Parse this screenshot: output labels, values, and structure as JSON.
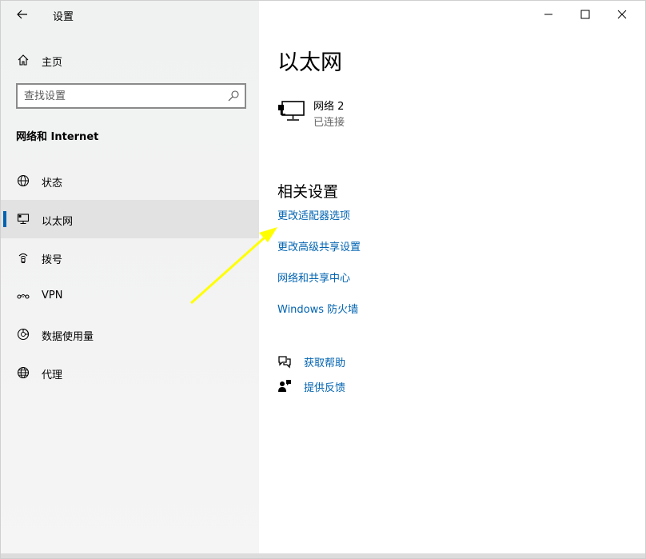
{
  "window": {
    "title": "设置",
    "controls": {
      "minimize": "minimize-icon",
      "maximize": "maximize-icon",
      "close": "close-icon"
    }
  },
  "sidebar": {
    "home_label": "主页",
    "search_placeholder": "查找设置",
    "section_title": "网络和 Internet",
    "items": [
      {
        "label": "状态",
        "icon": "globe-status-icon",
        "selected": false
      },
      {
        "label": "以太网",
        "icon": "ethernet-icon",
        "selected": true
      },
      {
        "label": "拨号",
        "icon": "dialup-icon",
        "selected": false
      },
      {
        "label": "VPN",
        "icon": "vpn-icon",
        "selected": false
      },
      {
        "label": "数据使用量",
        "icon": "data-usage-icon",
        "selected": false
      },
      {
        "label": "代理",
        "icon": "proxy-globe-icon",
        "selected": false
      }
    ]
  },
  "main": {
    "page_title": "以太网",
    "network": {
      "name": "网络 2",
      "status": "已连接"
    },
    "related_title": "相关设置",
    "links": [
      "更改适配器选项",
      "更改高级共享设置",
      "网络和共享中心",
      "Windows 防火墙"
    ],
    "help": [
      {
        "label": "获取帮助",
        "icon": "chat-help-icon"
      },
      {
        "label": "提供反馈",
        "icon": "feedback-icon"
      }
    ]
  },
  "colors": {
    "accent": "#0063b1",
    "sidebar_bg": "#f2f2f2",
    "selected_bg": "#e2e2e2",
    "annotation_arrow": "#ffff00"
  }
}
